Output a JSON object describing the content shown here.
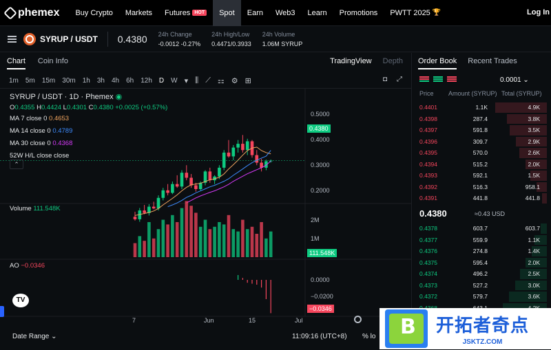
{
  "nav": {
    "brand": "phemex",
    "items": [
      "Buy Crypto",
      "Markets",
      "Futures",
      "Spot",
      "Earn",
      "Web3",
      "Learn",
      "Promotions",
      "PWTT 2025"
    ],
    "hot_badge": "HOT",
    "login": "Log In"
  },
  "ticker": {
    "pair": "SYRUP / USDT",
    "last_price": "0.4380",
    "change_label": "24h Change",
    "change_value": "-0.0012 -0.27%",
    "highlow_label": "24h High/Low",
    "highlow_value": "0.4471/0.3933",
    "volume_label": "24h Volume",
    "volume_value": "1.06M SYRUP"
  },
  "chart_tabs": {
    "chart": "Chart",
    "coin_info": "Coin Info",
    "tradingview": "TradingView",
    "depth": "Depth"
  },
  "intervals": [
    "1m",
    "5m",
    "15m",
    "30m",
    "1h",
    "3h",
    "4h",
    "6h",
    "12h",
    "D",
    "W"
  ],
  "legend": {
    "title": "SYRUP / USDT · 1D · Phemex",
    "ohlc_o_lbl": "O",
    "ohlc_o": "0.4355",
    "ohlc_h_lbl": "H",
    "ohlc_h": "0.4424",
    "ohlc_l_lbl": "L",
    "ohlc_l": "0.4301",
    "ohlc_c_lbl": "C",
    "ohlc_c": "0.4380",
    "ohlc_chg": "+0.0025 (+0.57%)",
    "ma7_lbl": "MA 7 close 0",
    "ma7": "0.4653",
    "ma14_lbl": "MA 14 close 0",
    "ma14": "0.4789",
    "ma30_lbl": "MA 30 close 0",
    "ma30": "0.4368",
    "hl": "52W H/L close close",
    "vol_lbl": "Volume",
    "vol_val": "111.548K",
    "ao_lbl": "AO",
    "ao_val": "−0.0346"
  },
  "chart_data": {
    "type": "candlestick",
    "price_axis_ticks": [
      "0.5000",
      "0.4000",
      "0.3000",
      "0.2000"
    ],
    "price_tag": "0.4380",
    "volume_axis_ticks": [
      "2M",
      "1M"
    ],
    "volume_tag": "111.548K",
    "ao_axis_ticks": [
      "0.0000",
      "−0.0200"
    ],
    "ao_tag": "−0.0346",
    "x_ticks": [
      "7",
      "Jun",
      "15",
      "Jul"
    ],
    "ylim": [
      0.15,
      0.56
    ],
    "candles": [
      {
        "o": 0.215,
        "h": 0.235,
        "l": 0.2,
        "c": 0.205
      },
      {
        "o": 0.205,
        "h": 0.25,
        "l": 0.195,
        "c": 0.24
      },
      {
        "o": 0.24,
        "h": 0.262,
        "l": 0.225,
        "c": 0.23
      },
      {
        "o": 0.23,
        "h": 0.265,
        "l": 0.22,
        "c": 0.255
      },
      {
        "o": 0.255,
        "h": 0.275,
        "l": 0.245,
        "c": 0.248
      },
      {
        "o": 0.248,
        "h": 0.3,
        "l": 0.24,
        "c": 0.29
      },
      {
        "o": 0.29,
        "h": 0.33,
        "l": 0.28,
        "c": 0.32
      },
      {
        "o": 0.32,
        "h": 0.345,
        "l": 0.3,
        "c": 0.31
      },
      {
        "o": 0.31,
        "h": 0.355,
        "l": 0.305,
        "c": 0.345
      },
      {
        "o": 0.345,
        "h": 0.38,
        "l": 0.33,
        "c": 0.335
      },
      {
        "o": 0.335,
        "h": 0.4,
        "l": 0.325,
        "c": 0.39
      },
      {
        "o": 0.39,
        "h": 0.42,
        "l": 0.36,
        "c": 0.37
      },
      {
        "o": 0.37,
        "h": 0.385,
        "l": 0.33,
        "c": 0.34
      },
      {
        "o": 0.34,
        "h": 0.35,
        "l": 0.315,
        "c": 0.325
      },
      {
        "o": 0.325,
        "h": 0.355,
        "l": 0.32,
        "c": 0.35
      },
      {
        "o": 0.35,
        "h": 0.4,
        "l": 0.34,
        "c": 0.395
      },
      {
        "o": 0.395,
        "h": 0.41,
        "l": 0.35,
        "c": 0.36
      },
      {
        "o": 0.36,
        "h": 0.38,
        "l": 0.345,
        "c": 0.375
      },
      {
        "o": 0.375,
        "h": 0.42,
        "l": 0.365,
        "c": 0.41
      },
      {
        "o": 0.41,
        "h": 0.48,
        "l": 0.4,
        "c": 0.47
      },
      {
        "o": 0.47,
        "h": 0.52,
        "l": 0.45,
        "c": 0.455
      },
      {
        "o": 0.455,
        "h": 0.5,
        "l": 0.44,
        "c": 0.49
      },
      {
        "o": 0.49,
        "h": 0.52,
        "l": 0.47,
        "c": 0.505
      },
      {
        "o": 0.505,
        "h": 0.54,
        "l": 0.47,
        "c": 0.48
      },
      {
        "o": 0.48,
        "h": 0.525,
        "l": 0.46,
        "c": 0.515
      },
      {
        "o": 0.515,
        "h": 0.52,
        "l": 0.45,
        "c": 0.46
      },
      {
        "o": 0.46,
        "h": 0.48,
        "l": 0.42,
        "c": 0.43
      },
      {
        "o": 0.43,
        "h": 0.445,
        "l": 0.395,
        "c": 0.41
      },
      {
        "o": 0.41,
        "h": 0.442,
        "l": 0.4,
        "c": 0.4355
      },
      {
        "o": 0.4355,
        "h": 0.4424,
        "l": 0.4301,
        "c": 0.438
      }
    ],
    "ma7": [
      0.22,
      0.224,
      0.228,
      0.232,
      0.238,
      0.248,
      0.262,
      0.275,
      0.288,
      0.302,
      0.318,
      0.332,
      0.342,
      0.345,
      0.348,
      0.355,
      0.362,
      0.366,
      0.372,
      0.385,
      0.405,
      0.422,
      0.44,
      0.46,
      0.478,
      0.488,
      0.492,
      0.478,
      0.47,
      0.465
    ],
    "ma14": [
      null,
      null,
      null,
      null,
      null,
      null,
      null,
      0.255,
      0.262,
      0.27,
      0.28,
      0.292,
      0.3,
      0.31,
      0.318,
      0.326,
      0.334,
      0.34,
      0.348,
      0.356,
      0.366,
      0.38,
      0.392,
      0.405,
      0.418,
      0.43,
      0.44,
      0.448,
      0.456,
      0.4789
    ],
    "ma30": [
      null,
      null,
      null,
      null,
      null,
      null,
      null,
      null,
      null,
      null,
      null,
      0.27,
      0.28,
      0.29,
      0.298,
      0.305,
      0.312,
      0.318,
      0.326,
      0.334,
      0.344,
      0.356,
      0.366,
      0.376,
      0.386,
      0.394,
      0.402,
      0.41,
      0.42,
      0.4368
    ],
    "volume": [
      0.6,
      0.9,
      0.7,
      1.5,
      0.8,
      1.2,
      1.6,
      1.4,
      1.8,
      1.5,
      2.1,
      2.4,
      2.2,
      1.9,
      1.3,
      1.6,
      1.2,
      1.3,
      1.5,
      1.4,
      1.8,
      1.2,
      1.1,
      1.6,
      1.2,
      1.3,
      1.0,
      1.5,
      0.8,
      1.1
    ],
    "ao": [
      null,
      null,
      null,
      null,
      null,
      null,
      null,
      null,
      null,
      null,
      null,
      null,
      null,
      null,
      null,
      null,
      null,
      null,
      null,
      null,
      null,
      null,
      0.005,
      0.002,
      -0.003,
      -0.004,
      -0.005,
      -0.008,
      -0.02,
      -0.0346
    ]
  },
  "bottom": {
    "date_range": "Date Range",
    "time": "11:09:16 (UTC+8)",
    "extra": "%  lo"
  },
  "book": {
    "tab_book": "Order Book",
    "tab_trades": "Recent Trades",
    "tick": "0.0001",
    "col_price": "Price",
    "col_amount": "Amount (SYRUP)",
    "col_total": "Total (SYRUP)",
    "asks": [
      {
        "p": "0.4401",
        "a": "1.1K",
        "t": "4.9K",
        "depth": 1.0
      },
      {
        "p": "0.4398",
        "a": "287.4",
        "t": "3.8K",
        "depth": 0.78
      },
      {
        "p": "0.4397",
        "a": "591.8",
        "t": "3.5K",
        "depth": 0.72
      },
      {
        "p": "0.4396",
        "a": "309.7",
        "t": "2.9K",
        "depth": 0.6
      },
      {
        "p": "0.4395",
        "a": "570.0",
        "t": "2.6K",
        "depth": 0.54
      },
      {
        "p": "0.4394",
        "a": "515.2",
        "t": "2.0K",
        "depth": 0.42
      },
      {
        "p": "0.4393",
        "a": "592.1",
        "t": "1.5K",
        "depth": 0.32
      },
      {
        "p": "0.4392",
        "a": "516.3",
        "t": "958.1",
        "depth": 0.2
      },
      {
        "p": "0.4391",
        "a": "441.8",
        "t": "441.8",
        "depth": 0.1
      }
    ],
    "mid_price": "0.4380",
    "mid_usd": "≈0.43 USD",
    "bids": [
      {
        "p": "0.4378",
        "a": "603.7",
        "t": "603.7",
        "depth": 0.12
      },
      {
        "p": "0.4377",
        "a": "559.9",
        "t": "1.1K",
        "depth": 0.24
      },
      {
        "p": "0.4376",
        "a": "274.8",
        "t": "1.4K",
        "depth": 0.3
      },
      {
        "p": "0.4375",
        "a": "595.4",
        "t": "2.0K",
        "depth": 0.42
      },
      {
        "p": "0.4374",
        "a": "496.2",
        "t": "2.5K",
        "depth": 0.52
      },
      {
        "p": "0.4373",
        "a": "527.2",
        "t": "3.0K",
        "depth": 0.62
      },
      {
        "p": "0.4372",
        "a": "579.7",
        "t": "3.6K",
        "depth": 0.74
      },
      {
        "p": "0.4368",
        "a": "643.1",
        "t": "4.2K",
        "depth": 0.86
      }
    ]
  },
  "ad": {
    "title": "开拓者奇点",
    "url": "JSKTZ.COM"
  },
  "colors": {
    "up": "#0ecb81",
    "down": "#f6465d",
    "ma7": "#f0a35e",
    "ma14": "#3d8bfd",
    "ma30": "#d63af9"
  }
}
